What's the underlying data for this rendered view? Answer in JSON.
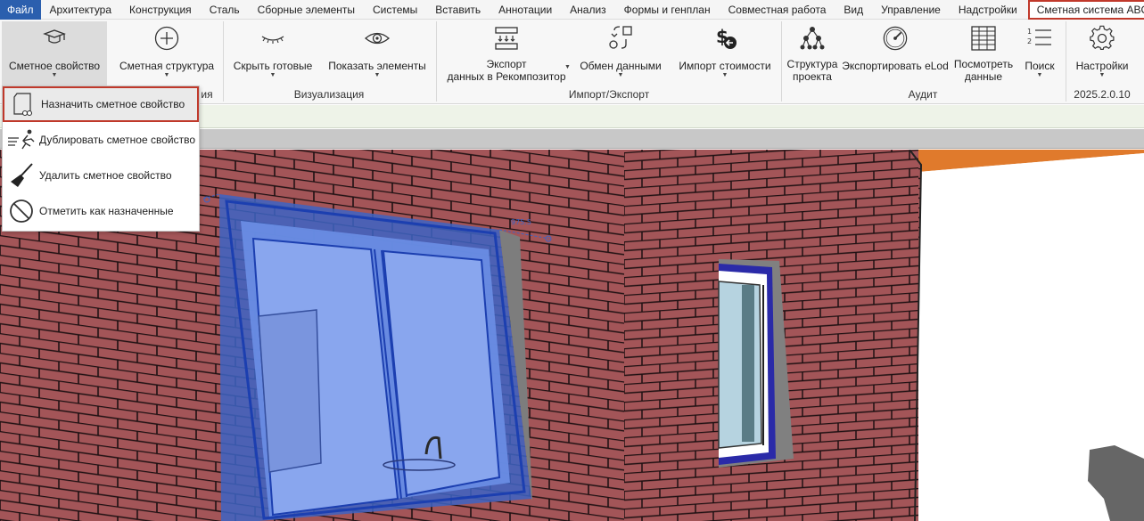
{
  "menubar": {
    "tabs": [
      "Файл",
      "Архитектура",
      "Конструкция",
      "Сталь",
      "Сборные элементы",
      "Системы",
      "Вставить",
      "Аннотации",
      "Анализ",
      "Формы и генплан",
      "Совместная работа",
      "Вид",
      "Управление",
      "Надстройки",
      "Сметная система ABC"
    ]
  },
  "ribbon": {
    "buttons": {
      "estimate_property": "Сметное свойство",
      "estimate_structure": "Сметная структура",
      "hide_done": "Скрыть готовые",
      "show_elements": "Показать элементы",
      "export_line1": "Экспорт",
      "export_line2": "данных в Рекомпозитор",
      "data_exchange": "Обмен данными",
      "import_cost": "Импорт стоимости",
      "project_structure_line1": "Структура",
      "project_structure_line2": "проекта",
      "export_elod": "Экспортировать eLod",
      "view_data_line1": "Посмотреть",
      "view_data_line2": "данные",
      "search": "Поиск",
      "settings": "Настройки"
    },
    "groups": {
      "partial": "ия",
      "visualization": "Визуализация",
      "import_export": "Импорт/Экспорт",
      "audit": "Аудит",
      "version": "2025.2.0.10"
    }
  },
  "dropdown": {
    "items": [
      {
        "label": "Назначить сметное свойство",
        "icon": "assign-property-icon"
      },
      {
        "label": "Дублировать сметное свойство",
        "icon": "duplicate-property-icon"
      },
      {
        "label": "Удалить сметное свойство",
        "icon": "broom-icon"
      },
      {
        "label": "Отметить как назначенные",
        "icon": "prohibited-icon"
      }
    ]
  },
  "viewport": {
    "dimension_text": "975.5"
  },
  "colors": {
    "file_tab": "#2b5fae",
    "highlight": "#c0392b",
    "brick": "#a35558",
    "mortar": "#1e1012",
    "window_selection": "#5b86e5",
    "roof": "#e07a2c"
  }
}
